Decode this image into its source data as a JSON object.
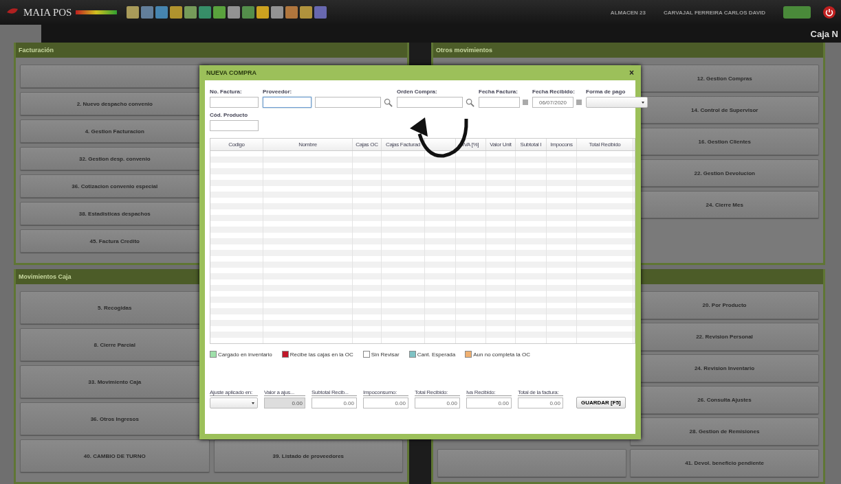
{
  "top_bar": {
    "logo": "MAIA POS",
    "store": "ALMACEN 23",
    "user": "CARVAJAL FERREIRA CARLOS DAVID"
  },
  "header_band": {
    "title": "Caja N"
  },
  "panels": [
    {
      "title": "Facturación",
      "left": [
        {
          "kind": "blank"
        },
        {
          "kind": "labeled",
          "label": "2. Nuevo despacho convenio"
        },
        {
          "kind": "labeled",
          "label": "4. Gestion Facturacion"
        },
        {
          "kind": "labeled",
          "label": "32. Gestion desp. convenio"
        },
        {
          "kind": "labeled",
          "label": "36. Cotizacion convenio especial"
        },
        {
          "kind": "labeled",
          "label": "38. Estadisticas despachos"
        },
        {
          "kind": "labeled",
          "label": "45. Factura Credito"
        }
      ]
    },
    {
      "title": "Otros movimientos",
      "right": [
        {
          "kind": "labeled",
          "label": "12. Gestion Compras"
        },
        {
          "kind": "labeled",
          "label": "14. Control de Supervisor"
        },
        {
          "kind": "labeled",
          "label": "16. Gestion Clientes"
        },
        {
          "kind": "labeled",
          "label": "22. Gestion Devolucion"
        },
        {
          "kind": "labeled",
          "label": "24. Cierre Mes"
        }
      ]
    },
    {
      "title": "Movimientos Caja",
      "left": [
        {
          "kind": "labeled",
          "label": "5. Recogidas"
        },
        {
          "kind": "labeled",
          "label": "8. Cierre Parcial"
        },
        {
          "kind": "labeled",
          "label": "33. Movimiento Caja"
        },
        {
          "kind": "labeled",
          "label": "36. Otros Ingresos"
        },
        {
          "kind": "labeled",
          "label": "40. CAMBIO DE TURNO"
        }
      ],
      "right": [
        {
          "kind": "labeled",
          "label": "39. Listado de proveedores"
        }
      ]
    },
    {
      "left": [
        {
          "kind": "blank"
        }
      ],
      "right": [
        {
          "kind": "labeled",
          "label": "20. Por Producto"
        },
        {
          "kind": "labeled",
          "label": "22. Revision Personal"
        },
        {
          "kind": "labeled",
          "label": "24. Revision Inventario"
        },
        {
          "kind": "labeled",
          "label": "26. Consulta Ajustes"
        },
        {
          "kind": "labeled",
          "label": "28. Gestion de Remisiones"
        },
        {
          "kind": "labeled",
          "label": "41. Devol. beneficio pendiente"
        }
      ]
    }
  ],
  "dialog": {
    "title": "NUEVA COMPRA",
    "close": "×",
    "fields": [
      {
        "label": "No. Factura:",
        "kind": "text",
        "focused": false
      },
      {
        "label": "Proveedor:",
        "kind": "text",
        "focused": true
      },
      {
        "kind": "search",
        "focused": false
      },
      {
        "label": "Orden Compra:",
        "kind": "search",
        "focused": false
      },
      {
        "label": "Fecha Factura:",
        "kind": "date",
        "focused": false
      },
      {
        "label": "Fecha Recibido:",
        "kind": "date",
        "value": "06/07/2020",
        "focused": false
      },
      {
        "label": "Forma de pago",
        "kind": "select",
        "focused": false
      }
    ],
    "product_field": {
      "label": "Cód. Producto"
    },
    "table": {
      "columns": [
        {
          "kind": "labeled",
          "label": "Codigo"
        },
        {
          "kind": "labeled",
          "label": "Nombre"
        },
        {
          "kind": "labeled",
          "label": "Cajas OC"
        },
        {
          "kind": "labeled",
          "label": "Cajas Facturad"
        },
        {
          "kind": "covered"
        },
        {
          "kind": "labeled",
          "label": "IVA [%]"
        },
        {
          "kind": "labeled",
          "label": "Valor Unit"
        },
        {
          "kind": "labeled",
          "label": "Subtotal I"
        },
        {
          "kind": "labeled",
          "label": "Impocons"
        },
        {
          "kind": "labeled",
          "label": "Total Recibido"
        }
      ]
    },
    "legend": [
      {
        "label": "Cargado en inventario",
        "color": "#9fe0aa"
      },
      {
        "label": "Recibe las cajas en la OC",
        "color": "#c0182a"
      },
      {
        "label": "Sin Revisar",
        "color": "#ffffff"
      },
      {
        "label": "Cant. Esperada",
        "color": "#7fc2c4"
      },
      {
        "label": "Aun no completa la OC",
        "color": "#f0b070"
      }
    ],
    "totals": [
      {
        "label": "Ajuste aplicado en:",
        "kind": "select"
      },
      {
        "label": "Valor a ajus...",
        "kind": "disabled",
        "value": "0.00"
      },
      {
        "label": "Subtotal Recib...",
        "kind": "number",
        "value": "0.00"
      },
      {
        "label": "Impoconsumo:",
        "kind": "number",
        "value": "0.00"
      },
      {
        "label": "Total Recibido:",
        "kind": "number",
        "value": "0.00"
      },
      {
        "label": "Iva Recibido:",
        "kind": "number",
        "value": "0.00"
      },
      {
        "label": "Total de la factura:",
        "kind": "number",
        "value": "0.00"
      }
    ],
    "save_button": "GUARDAR [F5]"
  }
}
